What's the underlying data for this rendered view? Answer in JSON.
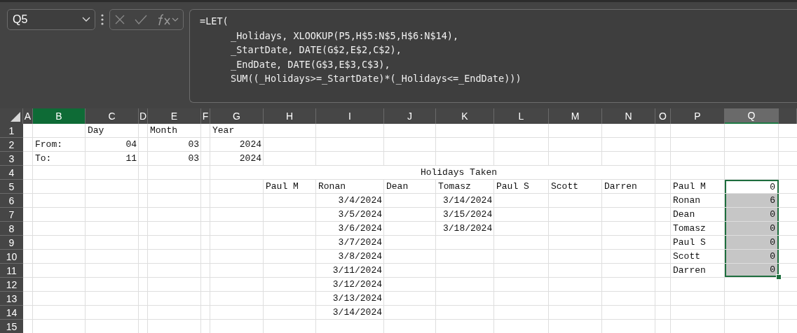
{
  "name_box": {
    "value": "Q5"
  },
  "formula": {
    "lines": [
      {
        "text": "=LET(",
        "indent": false
      },
      {
        "text": "_Holidays, XLOOKUP(P5,H$5:N$5,H$6:N$14),",
        "indent": true
      },
      {
        "text": "_StartDate, DATE(G$2,E$2,C$2),",
        "indent": true
      },
      {
        "text": "_EndDate, DATE(G$3,E$3,C$3),",
        "indent": true
      },
      {
        "text": "SUM((_Holidays>=_StartDate)*(_Holidays<=_EndDate)))",
        "indent": true
      }
    ]
  },
  "columns": [
    {
      "label": "A",
      "selected": false,
      "highlighted": false
    },
    {
      "label": "B",
      "selected": false,
      "highlighted": true
    },
    {
      "label": "C",
      "selected": false,
      "highlighted": false
    },
    {
      "label": "D",
      "selected": false,
      "highlighted": false
    },
    {
      "label": "E",
      "selected": false,
      "highlighted": false
    },
    {
      "label": "F",
      "selected": false,
      "highlighted": false
    },
    {
      "label": "G",
      "selected": false,
      "highlighted": false
    },
    {
      "label": "H",
      "selected": false,
      "highlighted": false
    },
    {
      "label": "I",
      "selected": false,
      "highlighted": false
    },
    {
      "label": "J",
      "selected": false,
      "highlighted": false
    },
    {
      "label": "K",
      "selected": false,
      "highlighted": false
    },
    {
      "label": "L",
      "selected": false,
      "highlighted": false
    },
    {
      "label": "M",
      "selected": false,
      "highlighted": false
    },
    {
      "label": "N",
      "selected": false,
      "highlighted": false
    },
    {
      "label": "O",
      "selected": false,
      "highlighted": false
    },
    {
      "label": "P",
      "selected": false,
      "highlighted": false
    },
    {
      "label": "Q",
      "selected": true,
      "highlighted": false
    }
  ],
  "rows": [
    {
      "label": "1",
      "cells": [
        null,
        null,
        {
          "text": "Day",
          "kind": "text",
          "selected": false
        },
        null,
        {
          "text": "Month",
          "kind": "text",
          "selected": false
        },
        null,
        {
          "text": "Year",
          "kind": "text",
          "selected": false
        },
        null,
        null,
        null,
        null,
        null,
        null,
        null,
        null,
        null,
        null
      ]
    },
    {
      "label": "2",
      "cells": [
        null,
        {
          "text": "From:",
          "kind": "text",
          "selected": false
        },
        {
          "text": "04",
          "kind": "number",
          "selected": false
        },
        null,
        {
          "text": "03",
          "kind": "number",
          "selected": false
        },
        null,
        {
          "text": "2024",
          "kind": "number",
          "selected": false
        },
        null,
        null,
        null,
        null,
        null,
        null,
        null,
        null,
        null,
        null
      ]
    },
    {
      "label": "3",
      "cells": [
        null,
        {
          "text": "To:",
          "kind": "text",
          "selected": false
        },
        {
          "text": "11",
          "kind": "number",
          "selected": false
        },
        null,
        {
          "text": "03",
          "kind": "number",
          "selected": false
        },
        null,
        {
          "text": "2024",
          "kind": "number",
          "selected": false
        },
        null,
        null,
        null,
        null,
        null,
        null,
        null,
        null,
        null,
        null
      ]
    },
    {
      "label": "4",
      "cells": [
        null,
        null,
        null,
        null,
        null,
        null,
        null,
        {
          "text": "Holidays Taken",
          "kind": "heading",
          "selected": false
        },
        null,
        null,
        null,
        null,
        null,
        null,
        null,
        null,
        null
      ]
    },
    {
      "label": "5",
      "cells": [
        null,
        null,
        null,
        null,
        null,
        null,
        null,
        {
          "text": "Paul M",
          "kind": "text",
          "selected": false
        },
        {
          "text": "Ronan",
          "kind": "text",
          "selected": false
        },
        {
          "text": "Dean",
          "kind": "text",
          "selected": false
        },
        {
          "text": "Tomasz",
          "kind": "text",
          "selected": false
        },
        {
          "text": "Paul S",
          "kind": "text",
          "selected": false
        },
        {
          "text": "Scott",
          "kind": "text",
          "selected": false
        },
        {
          "text": "Darren",
          "kind": "text",
          "selected": false
        },
        null,
        {
          "text": "Paul M",
          "kind": "text",
          "selected": false
        },
        {
          "text": "0",
          "kind": "number",
          "selected": true,
          "active": true
        }
      ]
    },
    {
      "label": "6",
      "cells": [
        null,
        null,
        null,
        null,
        null,
        null,
        null,
        null,
        {
          "text": "3/4/2024",
          "kind": "number",
          "selected": false
        },
        null,
        {
          "text": "3/14/2024",
          "kind": "indented",
          "selected": false
        },
        null,
        null,
        null,
        null,
        {
          "text": "Ronan",
          "kind": "text",
          "selected": false
        },
        {
          "text": "6",
          "kind": "number",
          "selected": true,
          "active": false
        }
      ]
    },
    {
      "label": "7",
      "cells": [
        null,
        null,
        null,
        null,
        null,
        null,
        null,
        null,
        {
          "text": "3/5/2024",
          "kind": "number",
          "selected": false
        },
        null,
        {
          "text": "3/15/2024",
          "kind": "indented",
          "selected": false
        },
        null,
        null,
        null,
        null,
        {
          "text": "Dean",
          "kind": "text",
          "selected": false
        },
        {
          "text": "0",
          "kind": "number",
          "selected": true,
          "active": false
        }
      ]
    },
    {
      "label": "8",
      "cells": [
        null,
        null,
        null,
        null,
        null,
        null,
        null,
        null,
        {
          "text": "3/6/2024",
          "kind": "number",
          "selected": false
        },
        null,
        {
          "text": "3/18/2024",
          "kind": "indented",
          "selected": false
        },
        null,
        null,
        null,
        null,
        {
          "text": "Tomasz",
          "kind": "text",
          "selected": false
        },
        {
          "text": "0",
          "kind": "number",
          "selected": true,
          "active": false
        }
      ]
    },
    {
      "label": "9",
      "cells": [
        null,
        null,
        null,
        null,
        null,
        null,
        null,
        null,
        {
          "text": "3/7/2024",
          "kind": "number",
          "selected": false
        },
        null,
        null,
        null,
        null,
        null,
        null,
        {
          "text": "Paul S",
          "kind": "text",
          "selected": false
        },
        {
          "text": "0",
          "kind": "number",
          "selected": true,
          "active": false
        }
      ]
    },
    {
      "label": "10",
      "cells": [
        null,
        null,
        null,
        null,
        null,
        null,
        null,
        null,
        {
          "text": "3/8/2024",
          "kind": "number",
          "selected": false
        },
        null,
        null,
        null,
        null,
        null,
        null,
        {
          "text": "Scott",
          "kind": "text",
          "selected": false
        },
        {
          "text": "0",
          "kind": "number",
          "selected": true,
          "active": false
        }
      ]
    },
    {
      "label": "11",
      "cells": [
        null,
        null,
        null,
        null,
        null,
        null,
        null,
        null,
        {
          "text": "3/11/2024",
          "kind": "number",
          "selected": false
        },
        null,
        null,
        null,
        null,
        null,
        null,
        {
          "text": "Darren",
          "kind": "text",
          "selected": false
        },
        {
          "text": "0",
          "kind": "number",
          "selected": true,
          "active": false
        }
      ]
    },
    {
      "label": "12",
      "cells": [
        null,
        null,
        null,
        null,
        null,
        null,
        null,
        null,
        {
          "text": "3/12/2024",
          "kind": "number",
          "selected": false
        },
        null,
        null,
        null,
        null,
        null,
        null,
        null,
        null
      ]
    },
    {
      "label": "13",
      "cells": [
        null,
        null,
        null,
        null,
        null,
        null,
        null,
        null,
        {
          "text": "3/13/2024",
          "kind": "number",
          "selected": false
        },
        null,
        null,
        null,
        null,
        null,
        null,
        null,
        null
      ]
    },
    {
      "label": "14",
      "cells": [
        null,
        null,
        null,
        null,
        null,
        null,
        null,
        null,
        {
          "text": "3/14/2024",
          "kind": "number",
          "selected": false
        },
        null,
        null,
        null,
        null,
        null,
        null,
        null,
        null
      ]
    },
    {
      "label": "15",
      "cells": [
        null,
        null,
        null,
        null,
        null,
        null,
        null,
        null,
        null,
        null,
        null,
        null,
        null,
        null,
        null,
        null,
        null
      ]
    }
  ]
}
